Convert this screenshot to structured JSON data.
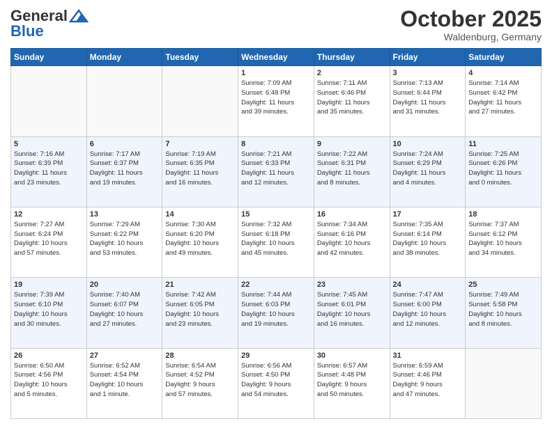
{
  "header": {
    "logo_general": "General",
    "logo_blue": "Blue",
    "month": "October 2025",
    "location": "Waldenburg, Germany"
  },
  "days_of_week": [
    "Sunday",
    "Monday",
    "Tuesday",
    "Wednesday",
    "Thursday",
    "Friday",
    "Saturday"
  ],
  "weeks": [
    [
      {
        "day": "",
        "info": ""
      },
      {
        "day": "",
        "info": ""
      },
      {
        "day": "",
        "info": ""
      },
      {
        "day": "1",
        "info": "Sunrise: 7:09 AM\nSunset: 6:48 PM\nDaylight: 11 hours\nand 39 minutes."
      },
      {
        "day": "2",
        "info": "Sunrise: 7:11 AM\nSunset: 6:46 PM\nDaylight: 11 hours\nand 35 minutes."
      },
      {
        "day": "3",
        "info": "Sunrise: 7:13 AM\nSunset: 6:44 PM\nDaylight: 11 hours\nand 31 minutes."
      },
      {
        "day": "4",
        "info": "Sunrise: 7:14 AM\nSunset: 6:42 PM\nDaylight: 11 hours\nand 27 minutes."
      }
    ],
    [
      {
        "day": "5",
        "info": "Sunrise: 7:16 AM\nSunset: 6:39 PM\nDaylight: 11 hours\nand 23 minutes."
      },
      {
        "day": "6",
        "info": "Sunrise: 7:17 AM\nSunset: 6:37 PM\nDaylight: 11 hours\nand 19 minutes."
      },
      {
        "day": "7",
        "info": "Sunrise: 7:19 AM\nSunset: 6:35 PM\nDaylight: 11 hours\nand 16 minutes."
      },
      {
        "day": "8",
        "info": "Sunrise: 7:21 AM\nSunset: 6:33 PM\nDaylight: 11 hours\nand 12 minutes."
      },
      {
        "day": "9",
        "info": "Sunrise: 7:22 AM\nSunset: 6:31 PM\nDaylight: 11 hours\nand 8 minutes."
      },
      {
        "day": "10",
        "info": "Sunrise: 7:24 AM\nSunset: 6:29 PM\nDaylight: 11 hours\nand 4 minutes."
      },
      {
        "day": "11",
        "info": "Sunrise: 7:25 AM\nSunset: 6:26 PM\nDaylight: 11 hours\nand 0 minutes."
      }
    ],
    [
      {
        "day": "12",
        "info": "Sunrise: 7:27 AM\nSunset: 6:24 PM\nDaylight: 10 hours\nand 57 minutes."
      },
      {
        "day": "13",
        "info": "Sunrise: 7:29 AM\nSunset: 6:22 PM\nDaylight: 10 hours\nand 53 minutes."
      },
      {
        "day": "14",
        "info": "Sunrise: 7:30 AM\nSunset: 6:20 PM\nDaylight: 10 hours\nand 49 minutes."
      },
      {
        "day": "15",
        "info": "Sunrise: 7:32 AM\nSunset: 6:18 PM\nDaylight: 10 hours\nand 45 minutes."
      },
      {
        "day": "16",
        "info": "Sunrise: 7:34 AM\nSunset: 6:16 PM\nDaylight: 10 hours\nand 42 minutes."
      },
      {
        "day": "17",
        "info": "Sunrise: 7:35 AM\nSunset: 6:14 PM\nDaylight: 10 hours\nand 38 minutes."
      },
      {
        "day": "18",
        "info": "Sunrise: 7:37 AM\nSunset: 6:12 PM\nDaylight: 10 hours\nand 34 minutes."
      }
    ],
    [
      {
        "day": "19",
        "info": "Sunrise: 7:39 AM\nSunset: 6:10 PM\nDaylight: 10 hours\nand 30 minutes."
      },
      {
        "day": "20",
        "info": "Sunrise: 7:40 AM\nSunset: 6:07 PM\nDaylight: 10 hours\nand 27 minutes."
      },
      {
        "day": "21",
        "info": "Sunrise: 7:42 AM\nSunset: 6:05 PM\nDaylight: 10 hours\nand 23 minutes."
      },
      {
        "day": "22",
        "info": "Sunrise: 7:44 AM\nSunset: 6:03 PM\nDaylight: 10 hours\nand 19 minutes."
      },
      {
        "day": "23",
        "info": "Sunrise: 7:45 AM\nSunset: 6:01 PM\nDaylight: 10 hours\nand 16 minutes."
      },
      {
        "day": "24",
        "info": "Sunrise: 7:47 AM\nSunset: 6:00 PM\nDaylight: 10 hours\nand 12 minutes."
      },
      {
        "day": "25",
        "info": "Sunrise: 7:49 AM\nSunset: 5:58 PM\nDaylight: 10 hours\nand 8 minutes."
      }
    ],
    [
      {
        "day": "26",
        "info": "Sunrise: 6:50 AM\nSunset: 4:56 PM\nDaylight: 10 hours\nand 5 minutes."
      },
      {
        "day": "27",
        "info": "Sunrise: 6:52 AM\nSunset: 4:54 PM\nDaylight: 10 hours\nand 1 minute."
      },
      {
        "day": "28",
        "info": "Sunrise: 6:54 AM\nSunset: 4:52 PM\nDaylight: 9 hours\nand 57 minutes."
      },
      {
        "day": "29",
        "info": "Sunrise: 6:56 AM\nSunset: 4:50 PM\nDaylight: 9 hours\nand 54 minutes."
      },
      {
        "day": "30",
        "info": "Sunrise: 6:57 AM\nSunset: 4:48 PM\nDaylight: 9 hours\nand 50 minutes."
      },
      {
        "day": "31",
        "info": "Sunrise: 6:59 AM\nSunset: 4:46 PM\nDaylight: 9 hours\nand 47 minutes."
      },
      {
        "day": "",
        "info": ""
      }
    ]
  ]
}
